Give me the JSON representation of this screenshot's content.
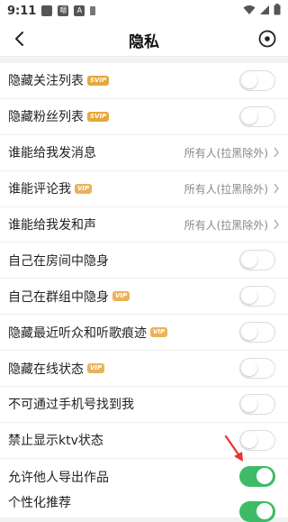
{
  "status_bar": {
    "time": "9:11",
    "icons": [
      "notification-icon",
      "app-icon",
      "alert-icon",
      "sim-icon"
    ],
    "icon_text": [
      "",
      "嗯",
      "A",
      ""
    ]
  },
  "header": {
    "title": "隐私",
    "back_icon": "chevron-left-icon",
    "record_icon": "record-icon"
  },
  "settings": [
    {
      "label": "隐藏关注列表",
      "badge": "SVIP",
      "control": "toggle",
      "on": false
    },
    {
      "label": "隐藏粉丝列表",
      "badge": "SVIP",
      "control": "toggle",
      "on": false
    },
    {
      "label": "谁能给我发消息",
      "badge": "",
      "control": "value",
      "value": "所有人(拉黑除外)"
    },
    {
      "label": "谁能评论我",
      "badge": "VIP",
      "control": "value",
      "value": "所有人(拉黑除外)"
    },
    {
      "label": "谁能给我发和声",
      "badge": "",
      "control": "value",
      "value": "所有人(拉黑除外)"
    },
    {
      "label": "自己在房间中隐身",
      "badge": "",
      "control": "toggle",
      "on": false
    },
    {
      "label": "自己在群组中隐身",
      "badge": "VIP",
      "control": "toggle",
      "on": false
    },
    {
      "label": "隐藏最近听众和听歌痕迹",
      "badge": "VIP",
      "control": "toggle",
      "on": false
    },
    {
      "label": "隐藏在线状态",
      "badge": "VIP",
      "control": "toggle",
      "on": false
    },
    {
      "label": "不可通过手机号找到我",
      "badge": "",
      "control": "toggle",
      "on": false
    },
    {
      "label": "禁止显示ktv状态",
      "badge": "",
      "control": "toggle",
      "on": false
    },
    {
      "label": "允许他人导出作品",
      "badge": "",
      "control": "toggle",
      "on": true
    }
  ],
  "section2": [
    {
      "label": "个性化推荐",
      "badge": "",
      "control": "toggle",
      "on": true
    }
  ],
  "colors": {
    "toggle_on": "#3dbb66",
    "badge": "#e6a73c",
    "annotation_arrow": "#e8332f"
  }
}
